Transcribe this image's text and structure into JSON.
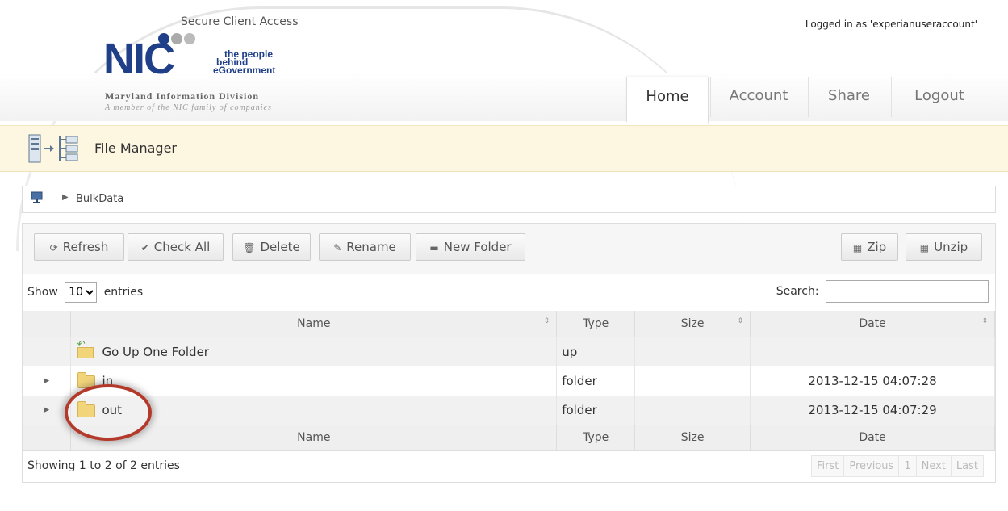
{
  "header": {
    "secure_title": "Secure Client Access",
    "logo_text": "NIC",
    "logo_tag_1": "the people",
    "logo_tag_2": "behind",
    "logo_tag_3": "eGovernment",
    "logo_division": "Maryland Information Division",
    "logo_member": "A member of the NIC family of companies",
    "logged_in": "Logged in as 'experianuseraccount'",
    "tabs": [
      {
        "label": "Home",
        "active": true
      },
      {
        "label": "Account",
        "active": false
      },
      {
        "label": "Share",
        "active": false
      },
      {
        "label": "Logout",
        "active": false
      }
    ]
  },
  "file_manager": {
    "title": "File Manager",
    "icon": "file-manager-icon"
  },
  "breadcrumb": {
    "root_icon": "computer-icon",
    "items": [
      "BulkData"
    ]
  },
  "toolbar": {
    "refresh": "Refresh",
    "check_all": "Check All",
    "delete": "Delete",
    "rename": "Rename",
    "new_folder": "New Folder",
    "zip": "Zip",
    "unzip": "Unzip"
  },
  "table_controls": {
    "show_label": "Show",
    "entries_value": "10",
    "entries_label": "entries",
    "search_label": "Search:",
    "search_value": ""
  },
  "table": {
    "headers": {
      "name": "Name",
      "type": "Type",
      "size": "Size",
      "date": "Date"
    },
    "rows": [
      {
        "name": "Go Up One Folder",
        "type": "up",
        "size": "",
        "date": "",
        "kind": "up"
      },
      {
        "name": "in",
        "type": "folder",
        "size": "",
        "date": "2013-12-15 04:07:28",
        "kind": "folder"
      },
      {
        "name": "out",
        "type": "folder",
        "size": "",
        "date": "2013-12-15 04:07:29",
        "kind": "folder"
      }
    ]
  },
  "footer": {
    "info": "Showing 1 to 2 of 2 entries",
    "pager": {
      "first": "First",
      "previous": "Previous",
      "page": "1",
      "next": "Next",
      "last": "Last"
    }
  },
  "colors": {
    "logo_blue": "#1f3f88",
    "highlight_circle": "#b33a2b",
    "bar_bg": "#fdf7e2"
  }
}
